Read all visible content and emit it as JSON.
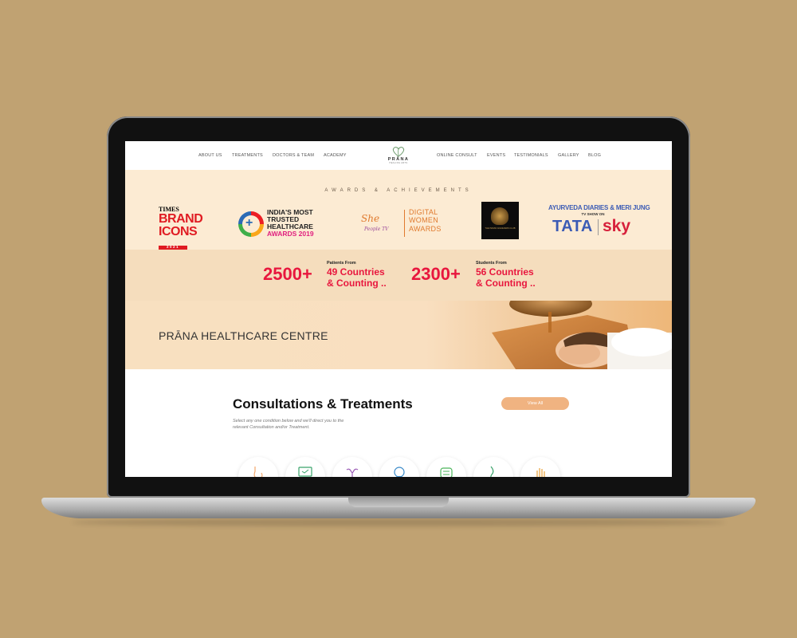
{
  "nav": {
    "left": [
      "ABOUT US",
      "TREATMENTS",
      "DOCTORS & TEAM",
      "ACADEMY"
    ],
    "right": [
      "ONLINE CONSULT",
      "EVENTS",
      "TESTIMONIALS",
      "GALLERY",
      "BLOG"
    ],
    "logo_text": "PRĀNA",
    "logo_sub": "HEALING ARTS"
  },
  "awards": {
    "title": "AWARDS & ACHIEVEMENTS",
    "times": {
      "line1": "TIMES",
      "line2": "BRAND",
      "line3": "ICONS",
      "year": "2021"
    },
    "trusted": {
      "line1": "INDIA'S MOST",
      "line2": "TRUSTED",
      "line3": "HEALTHCARE",
      "line4": "AWARDS 2019"
    },
    "she": {
      "script": "She",
      "sub": "People TV",
      "line1": "DIGITAL",
      "line2": "WOMEN",
      "line3": "AWARDS"
    },
    "society": {
      "text": "THE INDIAN ACHIEVERS CLUB"
    },
    "tata": {
      "line1": "AYURVEDA DIARIES & MERI JUNG",
      "line2": "TV SHOW ON",
      "brand": "TATA",
      "sky": "sky"
    }
  },
  "stats": [
    {
      "number": "2500+",
      "small": "Patients From",
      "line1": "49 Countries",
      "line2": "& Counting .."
    },
    {
      "number": "2300+",
      "small": "Students From",
      "line1": "56 Countries",
      "line2": "& Counting .."
    }
  ],
  "hero": {
    "title": "PRĀNA HEALTHCARE CENTRE"
  },
  "consult": {
    "title": "Consultations & Treatments",
    "desc": "Select any one condition below and we'll direct you to the relevant Consultation and/or Treatment.",
    "button": "View All"
  },
  "colors": {
    "accent": "#e8173e",
    "peach": "#fcebd3",
    "button": "#f0b381",
    "background": "#c0a272"
  }
}
